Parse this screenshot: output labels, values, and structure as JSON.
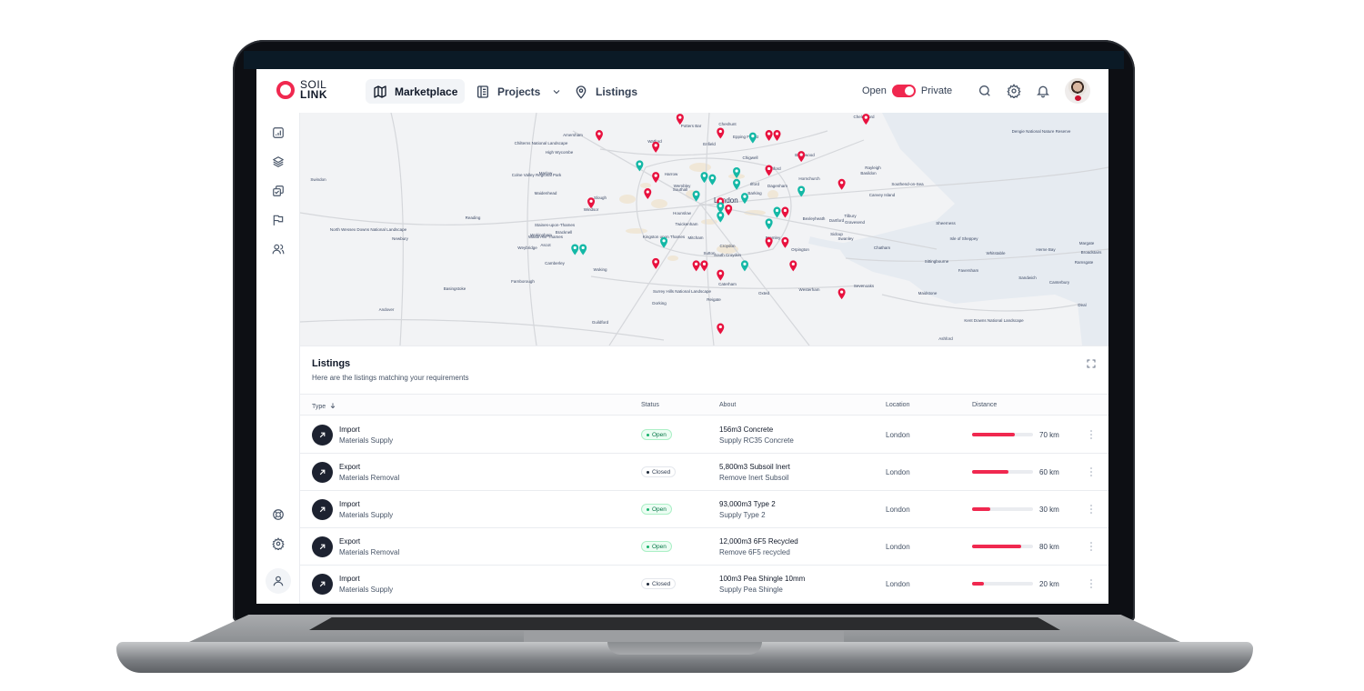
{
  "brand": {
    "line1": "SOIL",
    "line2": "LINK",
    "accent": "#f0284f"
  },
  "nav": {
    "items": [
      {
        "label": "Marketplace",
        "icon": "map-icon",
        "active": true
      },
      {
        "label": "Projects",
        "icon": "book-icon",
        "dropdown": true
      },
      {
        "label": "Listings",
        "icon": "location-pin-icon"
      }
    ],
    "visibility_toggle": {
      "left_label": "Open",
      "right_label": "Private",
      "state": "private"
    },
    "actions": [
      "search-icon",
      "gear-icon",
      "bell-icon"
    ]
  },
  "sidebar": {
    "top_items": [
      "bar-chart-icon",
      "layers-icon",
      "check-copy-icon",
      "flag-icon",
      "users-icon"
    ],
    "bottom_items": [
      "life-buoy-icon",
      "gear-icon",
      "user-icon"
    ]
  },
  "map": {
    "center_label": "London",
    "place_labels": [
      "Watford",
      "Potters Bar",
      "Cheshunt",
      "Epping Forest",
      "Enfield",
      "Chigwell",
      "Brentwood",
      "Harrow",
      "Wembley",
      "Romford",
      "Hornchurch",
      "Ilford",
      "Barking",
      "Dagenham",
      "Southall",
      "Slough",
      "Windsor",
      "Hounslow",
      "Twickenham",
      "Bexleyheath",
      "Dartford",
      "Sidcup",
      "Bromley",
      "Orpington",
      "Swanley",
      "Croydon",
      "South Croydon",
      "Sutton",
      "Epsom",
      "Kingston upon Thames",
      "Mitcham",
      "Caterham",
      "Sevenoaks",
      "Oxted",
      "Westerham",
      "Reigate",
      "Dorking",
      "Guildford",
      "Woking",
      "Weybridge",
      "Walton-on-Thames",
      "Staines-upon-Thames",
      "Colne Valley Regional Park",
      "Surrey Hills National Landscape",
      "Amersham",
      "High Wycombe",
      "Marlow",
      "Maidenhead",
      "Reading",
      "Wokingham",
      "Bracknell",
      "Ascot",
      "Camberley",
      "Farnborough",
      "Newbury",
      "Swindon",
      "Basingstoke",
      "Andover",
      "North Wessex Downs National Landscape",
      "Chilterns National Landscape",
      "Chelmsford",
      "Southend-on-Sea",
      "Basildon",
      "Rayleigh",
      "Canvey Island",
      "Tilbury",
      "Gravesend",
      "Chatham",
      "Sittingbourne",
      "Faversham",
      "Whitstable",
      "Herne Bay",
      "Margate",
      "Broadstairs",
      "Ramsgate",
      "Canterbury",
      "Sandwich",
      "Deal",
      "Maidstone",
      "Ashford",
      "Sheerness",
      "Isle of Sheppey",
      "Kent Downs National Landscape",
      "Dengie National Nature Reserve"
    ],
    "pins": {
      "red": [
        [
          0.47,
          0.02
        ],
        [
          0.37,
          0.09
        ],
        [
          0.52,
          0.08
        ],
        [
          0.58,
          0.09
        ],
        [
          0.59,
          0.09
        ],
        [
          0.44,
          0.14
        ],
        [
          0.62,
          0.18
        ],
        [
          0.58,
          0.24
        ],
        [
          0.44,
          0.27
        ],
        [
          0.36,
          0.38
        ],
        [
          0.43,
          0.34
        ],
        [
          0.52,
          0.38
        ],
        [
          0.53,
          0.41
        ],
        [
          0.6,
          0.42
        ],
        [
          0.58,
          0.55
        ],
        [
          0.6,
          0.55
        ],
        [
          0.44,
          0.64
        ],
        [
          0.49,
          0.65
        ],
        [
          0.5,
          0.65
        ],
        [
          0.52,
          0.69
        ],
        [
          0.61,
          0.65
        ],
        [
          0.67,
          0.77
        ],
        [
          0.52,
          0.92
        ],
        [
          0.7,
          0.02
        ],
        [
          0.67,
          0.3
        ]
      ],
      "teal": [
        [
          0.56,
          0.1
        ],
        [
          0.42,
          0.22
        ],
        [
          0.54,
          0.25
        ],
        [
          0.5,
          0.27
        ],
        [
          0.51,
          0.28
        ],
        [
          0.54,
          0.3
        ],
        [
          0.49,
          0.35
        ],
        [
          0.55,
          0.36
        ],
        [
          0.52,
          0.4
        ],
        [
          0.52,
          0.44
        ],
        [
          0.58,
          0.47
        ],
        [
          0.59,
          0.42
        ],
        [
          0.62,
          0.33
        ],
        [
          0.45,
          0.55
        ],
        [
          0.34,
          0.58
        ],
        [
          0.35,
          0.58
        ],
        [
          0.55,
          0.65
        ]
      ]
    }
  },
  "listings": {
    "title": "Listings",
    "subtitle": "Here are the listings matching your requirements",
    "columns": {
      "type": "Type",
      "sort_icon": "arrow-down-icon",
      "status": "Status",
      "about": "About",
      "location": "Location",
      "distance": "Distance"
    },
    "max_distance_km": 100,
    "rows": [
      {
        "type": "Import",
        "category": "Materials Supply",
        "status": "Open",
        "about": "156m3 Concrete",
        "about_sub": "Supply RC35 Concrete",
        "location": "London",
        "distance_km": 70,
        "distance_label": "70 km"
      },
      {
        "type": "Export",
        "category": "Materials Removal",
        "status": "Closed",
        "about": "5,800m3 Subsoil Inert",
        "about_sub": "Remove Inert Subsoil",
        "location": "London",
        "distance_km": 60,
        "distance_label": "60 km"
      },
      {
        "type": "Import",
        "category": "Materials Supply",
        "status": "Open",
        "about": "93,000m3 Type 2",
        "about_sub": "Supply Type 2",
        "location": "London",
        "distance_km": 30,
        "distance_label": "30 km"
      },
      {
        "type": "Export",
        "category": "Materials Removal",
        "status": "Open",
        "about": "12,000m3 6F5 Recycled",
        "about_sub": "Remove 6F5 recycled",
        "location": "London",
        "distance_km": 80,
        "distance_label": "80 km"
      },
      {
        "type": "Import",
        "category": "Materials Supply",
        "status": "Closed",
        "about": "100m3 Pea Shingle 10mm",
        "about_sub": "Supply Pea Shingle",
        "location": "London",
        "distance_km": 20,
        "distance_label": "20 km"
      }
    ]
  }
}
